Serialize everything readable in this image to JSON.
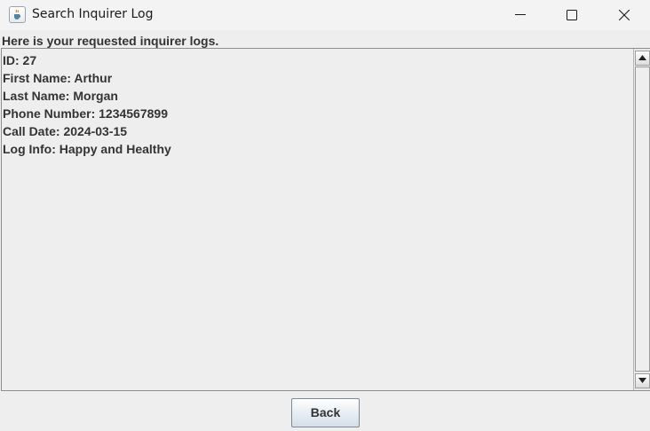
{
  "window": {
    "title": "Search Inquirer Log",
    "icon": "java-cup-icon"
  },
  "window_controls": {
    "minimize_icon": "minimize-icon",
    "maximize_icon": "maximize-icon",
    "close_icon": "close-icon"
  },
  "header": {
    "label": "Here is your requested inquirer logs."
  },
  "log": {
    "lines": [
      "ID: 27",
      "First Name: Arthur",
      "Last Name: Morgan",
      "Phone Number: 1234567899",
      "Call Date: 2024-03-15",
      "Log Info: Happy and Healthy"
    ]
  },
  "footer": {
    "back_label": "Back"
  },
  "colors": {
    "background": "#eeeeee",
    "titlebar": "#f3f3f3",
    "text": "#333333",
    "border": "#8e8e8e"
  }
}
